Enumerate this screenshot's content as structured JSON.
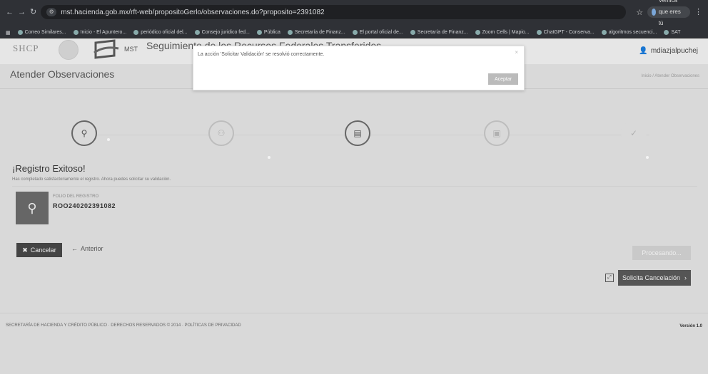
{
  "browser": {
    "url": "mst.hacienda.gob.mx/rft-web/propositoGerlo/observaciones.do?proposito=2391082",
    "profile_label": "Verifica que eres tú",
    "bookmarks": [
      "Correo Similares...",
      "Inicio - El Apuntero...",
      "periódico oficial del...",
      "Consejo juridico fed...",
      "Pública",
      "Secretaría de Finanz...",
      "El portal oficial de...",
      "Secretaría de Finanz...",
      "Zoom Cells | Mapio...",
      "ChatGPT - Conserva...",
      "algoritmos secuenci...",
      "SAT"
    ]
  },
  "header": {
    "org": "SHCP",
    "mst": "MST",
    "title": "Seguimiento de los Recursos Federales Transferidos",
    "user": "mdiazjalpuchej"
  },
  "section": {
    "title": "Atender Observaciones",
    "breadcrumb": "Inicio / Atender Observaciones"
  },
  "success": {
    "title": "¡Registro Exitoso!",
    "subtitle": "Has completado satisfactoriamente el registro. Ahora puedes solicitar su validación.",
    "folio_label": "FOLIO DEL REGISTRO",
    "folio_value": "ROO240202391082"
  },
  "buttons": {
    "cancel": "Cancelar",
    "previous": "Anterior",
    "next": "Procesando...",
    "solicita": "Solicita Cancelación"
  },
  "footer": {
    "text": "SECRETARÍA DE HACIENDA Y CRÉDITO PÚBLICO · DERECHOS RESERVADOS © 2014 · POLÍTICAS DE PRIVACIDAD",
    "version": "Versión 1.0"
  },
  "modal": {
    "message": "La acción 'Solicitar Validación' se resolvió correctamente.",
    "ok": "Aceptar"
  }
}
